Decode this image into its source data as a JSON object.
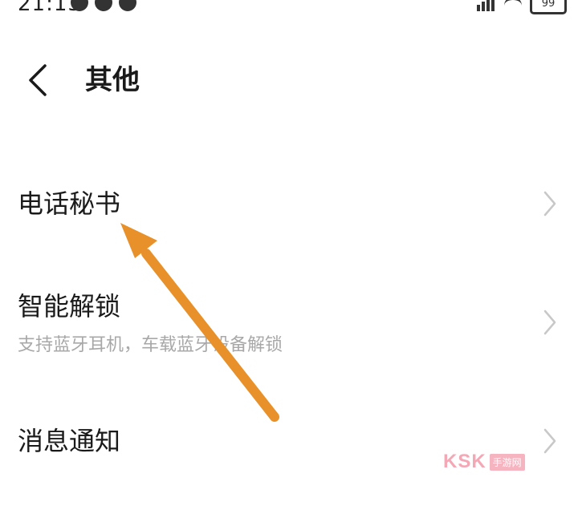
{
  "status_bar": {
    "time": "21:13",
    "battery": "99"
  },
  "header": {
    "title": "其他"
  },
  "settings": {
    "items": [
      {
        "title": "电话秘书",
        "subtitle": ""
      },
      {
        "title": "智能解锁",
        "subtitle": "支持蓝牙耳机，车载蓝牙设备解锁"
      },
      {
        "title": "消息通知",
        "subtitle": ""
      }
    ]
  },
  "watermark": {
    "text": "KSK",
    "badge": "手游网"
  },
  "colors": {
    "annotation_arrow": "#e8912a",
    "subtitle_gray": "#a8a8a8",
    "chevron_gray": "#c8c8c8"
  },
  "icons": {
    "back": "chevron-left-icon",
    "item_chevron": "chevron-right-icon"
  }
}
